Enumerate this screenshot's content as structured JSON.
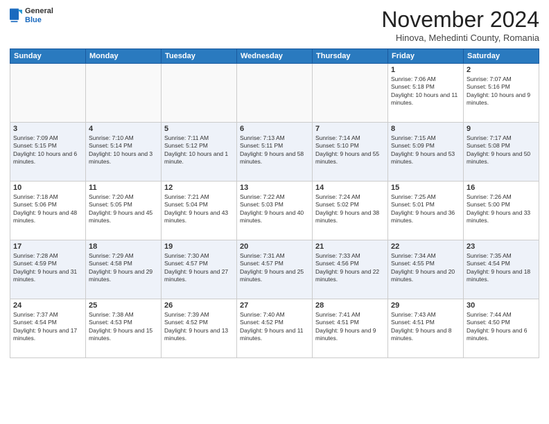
{
  "header": {
    "logo_general": "General",
    "logo_blue": "Blue",
    "month": "November 2024",
    "location": "Hinova, Mehedinti County, Romania"
  },
  "weekdays": [
    "Sunday",
    "Monday",
    "Tuesday",
    "Wednesday",
    "Thursday",
    "Friday",
    "Saturday"
  ],
  "weeks": [
    [
      {
        "day": "",
        "info": ""
      },
      {
        "day": "",
        "info": ""
      },
      {
        "day": "",
        "info": ""
      },
      {
        "day": "",
        "info": ""
      },
      {
        "day": "",
        "info": ""
      },
      {
        "day": "1",
        "info": "Sunrise: 7:06 AM\nSunset: 5:18 PM\nDaylight: 10 hours and 11 minutes."
      },
      {
        "day": "2",
        "info": "Sunrise: 7:07 AM\nSunset: 5:16 PM\nDaylight: 10 hours and 9 minutes."
      }
    ],
    [
      {
        "day": "3",
        "info": "Sunrise: 7:09 AM\nSunset: 5:15 PM\nDaylight: 10 hours and 6 minutes."
      },
      {
        "day": "4",
        "info": "Sunrise: 7:10 AM\nSunset: 5:14 PM\nDaylight: 10 hours and 3 minutes."
      },
      {
        "day": "5",
        "info": "Sunrise: 7:11 AM\nSunset: 5:12 PM\nDaylight: 10 hours and 1 minute."
      },
      {
        "day": "6",
        "info": "Sunrise: 7:13 AM\nSunset: 5:11 PM\nDaylight: 9 hours and 58 minutes."
      },
      {
        "day": "7",
        "info": "Sunrise: 7:14 AM\nSunset: 5:10 PM\nDaylight: 9 hours and 55 minutes."
      },
      {
        "day": "8",
        "info": "Sunrise: 7:15 AM\nSunset: 5:09 PM\nDaylight: 9 hours and 53 minutes."
      },
      {
        "day": "9",
        "info": "Sunrise: 7:17 AM\nSunset: 5:08 PM\nDaylight: 9 hours and 50 minutes."
      }
    ],
    [
      {
        "day": "10",
        "info": "Sunrise: 7:18 AM\nSunset: 5:06 PM\nDaylight: 9 hours and 48 minutes."
      },
      {
        "day": "11",
        "info": "Sunrise: 7:20 AM\nSunset: 5:05 PM\nDaylight: 9 hours and 45 minutes."
      },
      {
        "day": "12",
        "info": "Sunrise: 7:21 AM\nSunset: 5:04 PM\nDaylight: 9 hours and 43 minutes."
      },
      {
        "day": "13",
        "info": "Sunrise: 7:22 AM\nSunset: 5:03 PM\nDaylight: 9 hours and 40 minutes."
      },
      {
        "day": "14",
        "info": "Sunrise: 7:24 AM\nSunset: 5:02 PM\nDaylight: 9 hours and 38 minutes."
      },
      {
        "day": "15",
        "info": "Sunrise: 7:25 AM\nSunset: 5:01 PM\nDaylight: 9 hours and 36 minutes."
      },
      {
        "day": "16",
        "info": "Sunrise: 7:26 AM\nSunset: 5:00 PM\nDaylight: 9 hours and 33 minutes."
      }
    ],
    [
      {
        "day": "17",
        "info": "Sunrise: 7:28 AM\nSunset: 4:59 PM\nDaylight: 9 hours and 31 minutes."
      },
      {
        "day": "18",
        "info": "Sunrise: 7:29 AM\nSunset: 4:58 PM\nDaylight: 9 hours and 29 minutes."
      },
      {
        "day": "19",
        "info": "Sunrise: 7:30 AM\nSunset: 4:57 PM\nDaylight: 9 hours and 27 minutes."
      },
      {
        "day": "20",
        "info": "Sunrise: 7:31 AM\nSunset: 4:57 PM\nDaylight: 9 hours and 25 minutes."
      },
      {
        "day": "21",
        "info": "Sunrise: 7:33 AM\nSunset: 4:56 PM\nDaylight: 9 hours and 22 minutes."
      },
      {
        "day": "22",
        "info": "Sunrise: 7:34 AM\nSunset: 4:55 PM\nDaylight: 9 hours and 20 minutes."
      },
      {
        "day": "23",
        "info": "Sunrise: 7:35 AM\nSunset: 4:54 PM\nDaylight: 9 hours and 18 minutes."
      }
    ],
    [
      {
        "day": "24",
        "info": "Sunrise: 7:37 AM\nSunset: 4:54 PM\nDaylight: 9 hours and 17 minutes."
      },
      {
        "day": "25",
        "info": "Sunrise: 7:38 AM\nSunset: 4:53 PM\nDaylight: 9 hours and 15 minutes."
      },
      {
        "day": "26",
        "info": "Sunrise: 7:39 AM\nSunset: 4:52 PM\nDaylight: 9 hours and 13 minutes."
      },
      {
        "day": "27",
        "info": "Sunrise: 7:40 AM\nSunset: 4:52 PM\nDaylight: 9 hours and 11 minutes."
      },
      {
        "day": "28",
        "info": "Sunrise: 7:41 AM\nSunset: 4:51 PM\nDaylight: 9 hours and 9 minutes."
      },
      {
        "day": "29",
        "info": "Sunrise: 7:43 AM\nSunset: 4:51 PM\nDaylight: 9 hours and 8 minutes."
      },
      {
        "day": "30",
        "info": "Sunrise: 7:44 AM\nSunset: 4:50 PM\nDaylight: 9 hours and 6 minutes."
      }
    ]
  ]
}
